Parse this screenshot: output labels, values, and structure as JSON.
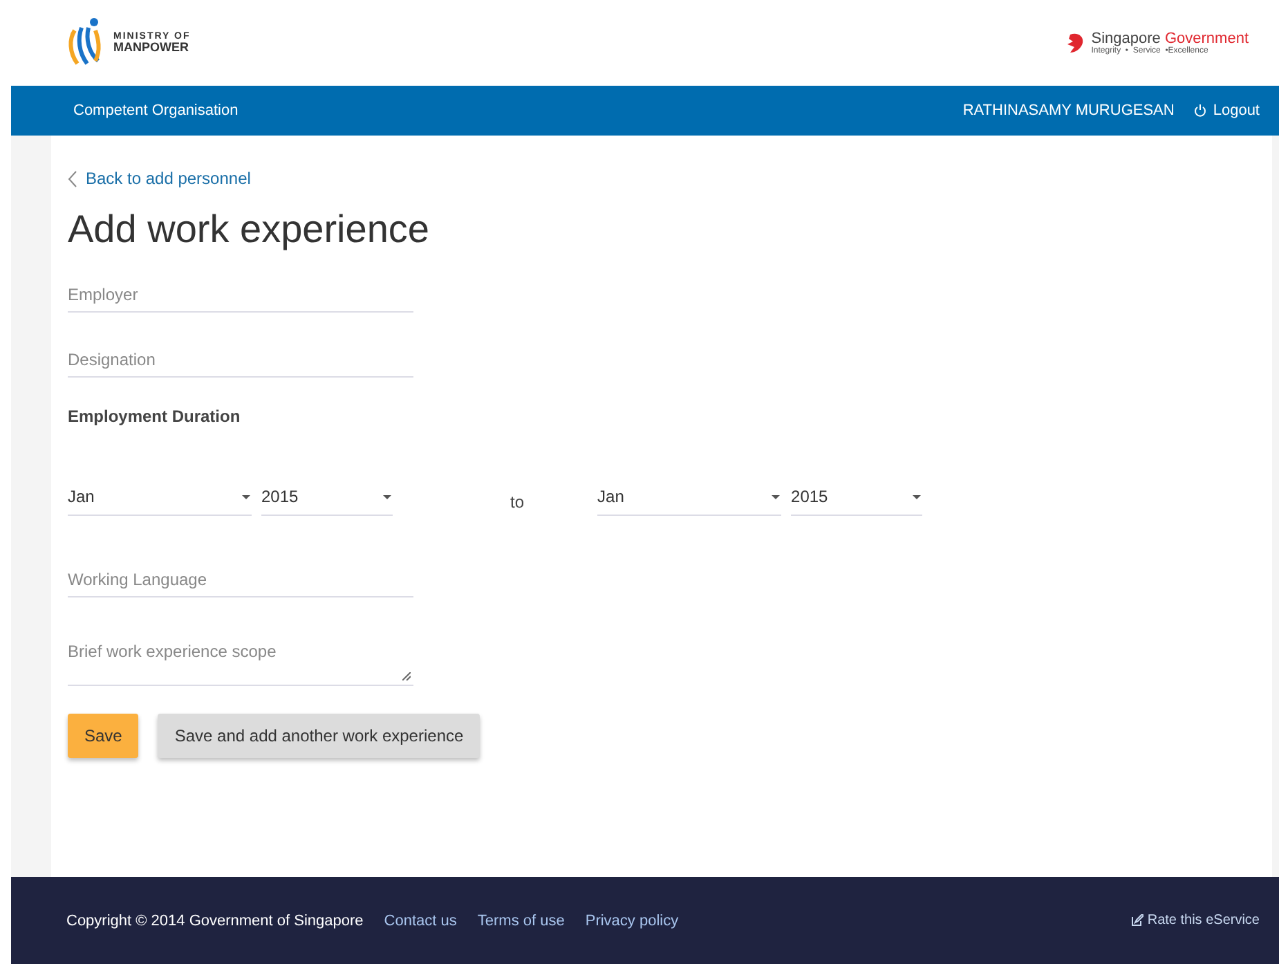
{
  "header": {
    "logo_line1": "MINISTRY OF",
    "logo_line2": "MANPOWER",
    "gov_name_1": "Singapore",
    "gov_name_2": "Government",
    "gov_tagline": "Integrity  •  Service  •Excellence"
  },
  "navbar": {
    "title": "Competent Organisation",
    "user": "RATHINASAMY MURUGESAN",
    "logout": "Logout"
  },
  "back_link": "Back to add personnel",
  "heading": "Add work experience",
  "fields_top": [
    {
      "placeholder": "Employer"
    },
    {
      "placeholder": "Designation"
    }
  ],
  "duration": {
    "label": "Employment Duration",
    "from_month": "Jan",
    "from_year": "2015",
    "separator": "to",
    "to_month": "Jan",
    "to_year": "2015"
  },
  "language": {
    "placeholder": "Working Language"
  },
  "scope": {
    "placeholder": "Brief work experience scope"
  },
  "buttons": [
    {
      "label": "Save",
      "kind": "primary"
    },
    {
      "label": "Save and add another work experience",
      "kind": "secondary"
    }
  ],
  "footer": {
    "copyright": "Copyright © 2014 Government of Singapore",
    "links": [
      "Contact us",
      "Terms of use",
      "Privacy policy"
    ],
    "rate": "Rate this eService"
  }
}
